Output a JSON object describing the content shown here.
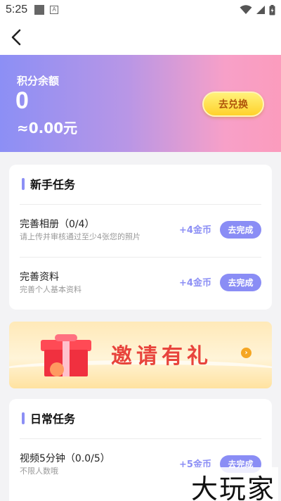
{
  "status_bar": {
    "time": "5:25",
    "a_icon": "A"
  },
  "hero": {
    "label": "积分余额",
    "points": "0",
    "money": "≈0.00元",
    "exchange_button": "去兑换"
  },
  "novice_tasks": {
    "title": "新手任务",
    "items": [
      {
        "title": "完善相册（0/4）",
        "desc": "请上传并审核通过至少4张您的照片",
        "reward": "+4金币",
        "button": "去完成"
      },
      {
        "title": "完善资料",
        "desc": "完善个人基本资料",
        "reward": "+4金币",
        "button": "去完成"
      }
    ]
  },
  "invite_banner": {
    "text": "邀请有礼"
  },
  "daily_tasks": {
    "title": "日常任务",
    "items": [
      {
        "title": "视频5分钟（0.0/5）",
        "desc": "不限人数哦",
        "reward": "+5金币",
        "button": "去完成"
      }
    ]
  },
  "watermark": "大玩家",
  "colors": {
    "accent": "#8c8ff5",
    "button_yellow": "#ffd12b",
    "banner_red": "#e8443c"
  }
}
